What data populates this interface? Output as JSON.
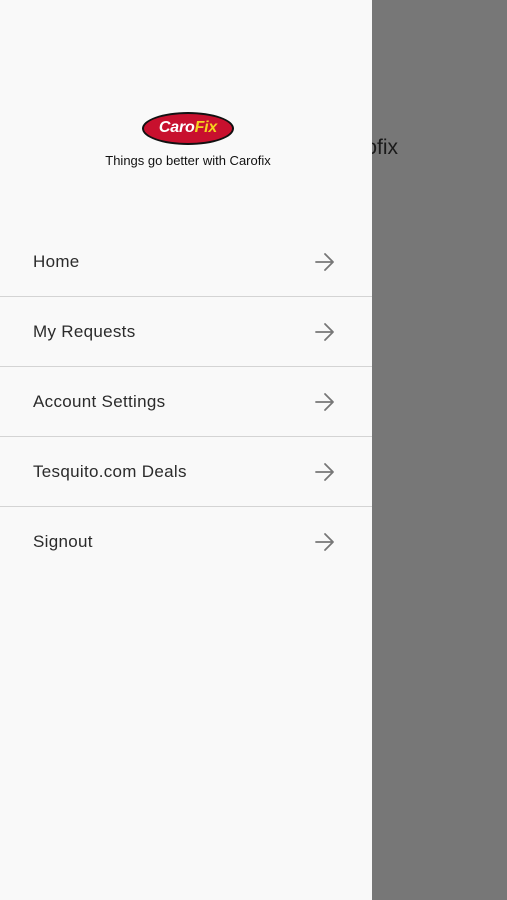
{
  "background": {
    "title_fragment": "ofix"
  },
  "logo": {
    "brand_caro": "Caro",
    "brand_fix": "Fix",
    "tagline": "Things go better with Carofix"
  },
  "menu": {
    "items": [
      {
        "label": "Home",
        "icon": "arrow-right-icon"
      },
      {
        "label": "My Requests",
        "icon": "arrow-right-icon"
      },
      {
        "label": "Account Settings",
        "icon": "arrow-right-icon"
      },
      {
        "label": "Tesquito.com Deals",
        "icon": "arrow-right-icon"
      },
      {
        "label": "Signout",
        "icon": "arrow-right-icon"
      }
    ]
  },
  "colors": {
    "drawer_bg": "#f9f9f9",
    "overlay": "#777777",
    "logo_red": "#c8102e",
    "logo_yellow": "#f4d21f"
  }
}
